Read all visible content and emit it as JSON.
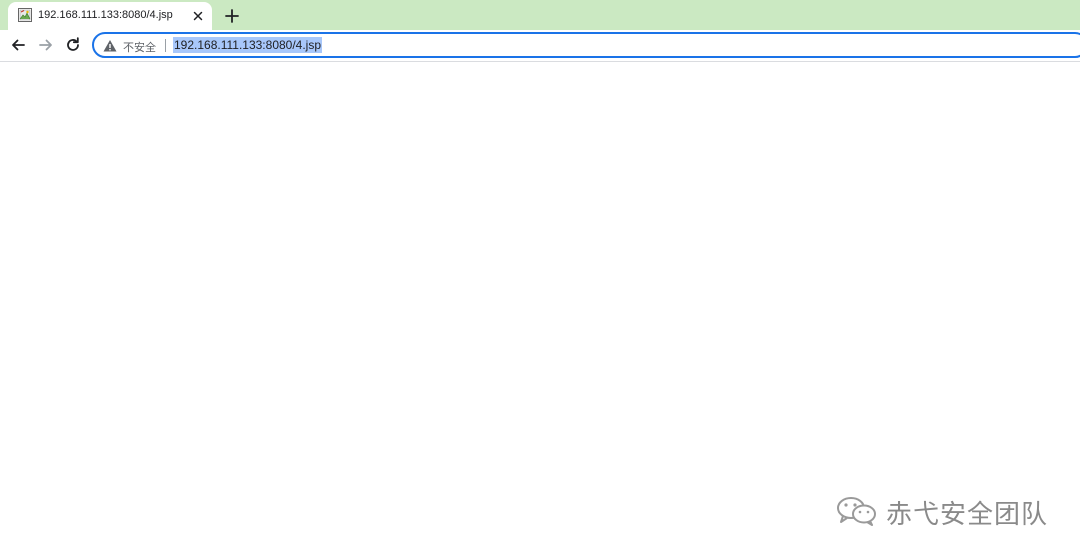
{
  "tab": {
    "title": "192.168.111.133:8080/4.jsp",
    "favicon": "broken-image-icon",
    "close_icon": "close-icon"
  },
  "new_tab_icon": "plus-icon",
  "toolbar": {
    "back_icon": "back-arrow-icon",
    "forward_icon": "forward-arrow-icon",
    "reload_icon": "reload-icon"
  },
  "omnibox": {
    "security_icon": "warning-icon",
    "security_label": "不安全",
    "url": "192.168.111.133:8080/4.jsp"
  },
  "watermark": {
    "icon": "wechat-icon",
    "text": "赤弋安全团队"
  },
  "colors": {
    "tabstrip": "#cbe9c2",
    "focus_ring": "#1a73e8",
    "selection": "#a8c7fa",
    "watermark": "#8a8a8a"
  }
}
